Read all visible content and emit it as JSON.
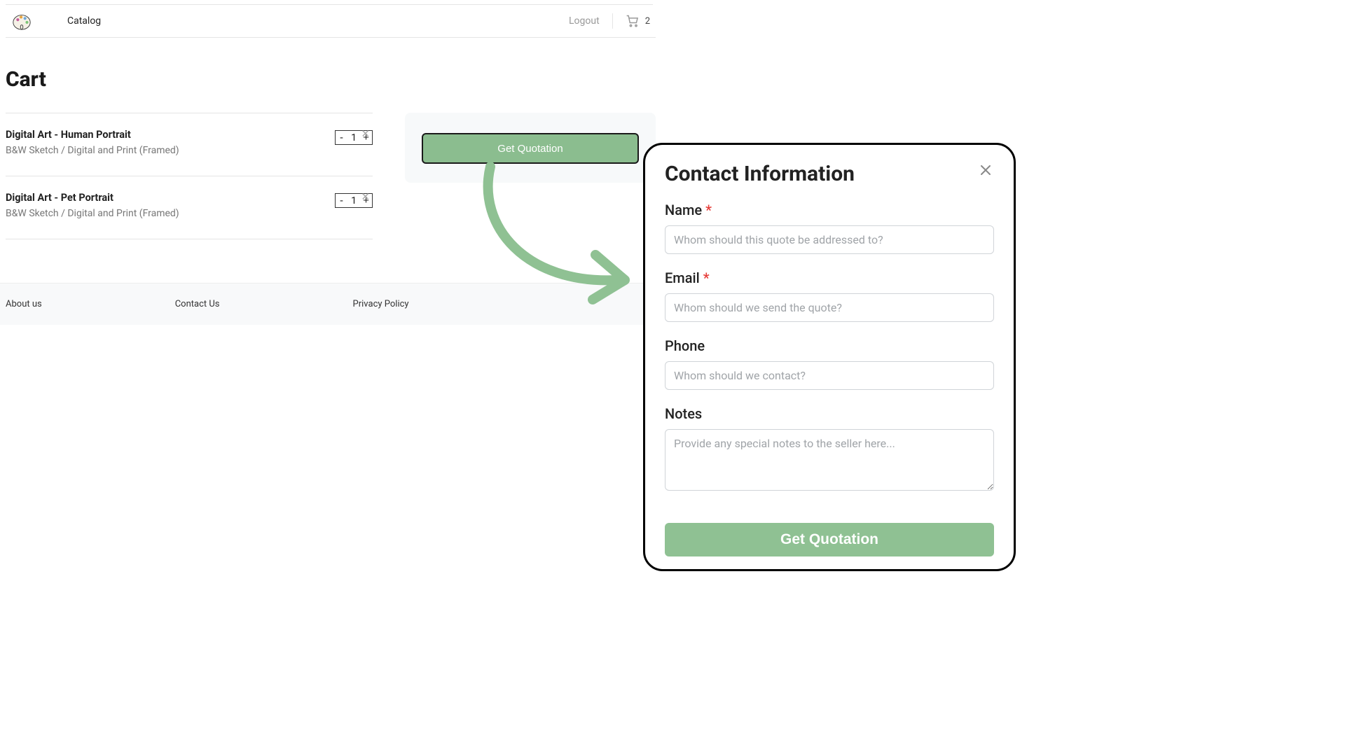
{
  "nav": {
    "catalog": "Catalog",
    "logout": "Logout",
    "cart_count": "2"
  },
  "page": {
    "title": "Cart"
  },
  "items": [
    {
      "title": "Digital Art - Human Portrait",
      "sub": "B&W Sketch / Digital and Print (Framed)",
      "qty": "1"
    },
    {
      "title": "Digital Art - Pet Portrait",
      "sub": "B&W Sketch / Digital and Print (Framed)",
      "qty": "1"
    }
  ],
  "summary": {
    "button": "Get Quotation"
  },
  "footer": {
    "about": "About us",
    "contact": "Contact Us",
    "privacy": "Privacy Policy"
  },
  "modal": {
    "title": "Contact Information",
    "name_label": "Name",
    "name_ph": "Whom should this quote be addressed to?",
    "email_label": "Email",
    "email_ph": "Whom should we send the quote?",
    "phone_label": "Phone",
    "phone_ph": "Whom should we contact?",
    "notes_label": "Notes",
    "notes_ph": "Provide any special notes to the seller here...",
    "submit": "Get Quotation",
    "required": "*"
  }
}
